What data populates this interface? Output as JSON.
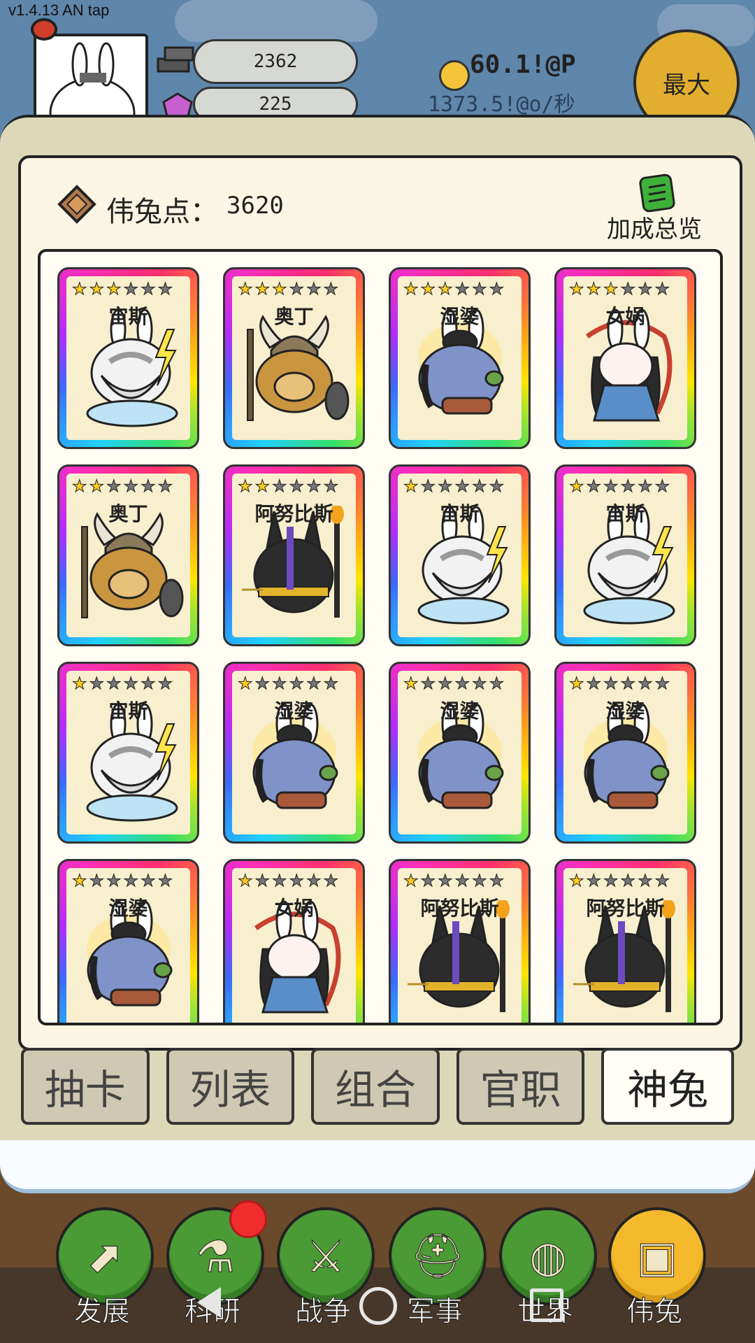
{
  "version": "v1.4.13 AN tap",
  "resources": {
    "iron": "2362",
    "gems": "225"
  },
  "income": {
    "coin_rate": "60.1!@P",
    "coin_per_sec": "1373.5!@o/秒"
  },
  "max_button": "最大",
  "panel": {
    "points_label": "伟兔点：",
    "points_value": "3620",
    "bonus_overview": "加成总览"
  },
  "cards": [
    {
      "name": "宙斯",
      "stars": 3,
      "char": "zeus"
    },
    {
      "name": "奥丁",
      "stars": 3,
      "char": "odin"
    },
    {
      "name": "湿婆",
      "stars": 3,
      "char": "shiva"
    },
    {
      "name": "女娲",
      "stars": 3,
      "char": "nuwa"
    },
    {
      "name": "奥丁",
      "stars": 2,
      "char": "odin"
    },
    {
      "name": "阿努比斯",
      "stars": 2,
      "char": "anubis"
    },
    {
      "name": "宙斯",
      "stars": 1,
      "char": "zeus"
    },
    {
      "name": "宙斯",
      "stars": 1,
      "char": "zeus"
    },
    {
      "name": "宙斯",
      "stars": 1,
      "char": "zeus"
    },
    {
      "name": "湿婆",
      "stars": 1,
      "char": "shiva"
    },
    {
      "name": "湿婆",
      "stars": 1,
      "char": "shiva"
    },
    {
      "name": "湿婆",
      "stars": 1,
      "char": "shiva"
    },
    {
      "name": "湿婆",
      "stars": 1,
      "char": "shiva"
    },
    {
      "name": "女娲",
      "stars": 1,
      "char": "nuwa"
    },
    {
      "name": "阿努比斯",
      "stars": 1,
      "char": "anubis"
    },
    {
      "name": "阿努比斯",
      "stars": 1,
      "char": "anubis"
    }
  ],
  "tabs": [
    {
      "label": "抽卡",
      "active": false
    },
    {
      "label": "列表",
      "active": false
    },
    {
      "label": "组合",
      "active": false
    },
    {
      "label": "官职",
      "active": false
    },
    {
      "label": "神兔",
      "active": true
    }
  ],
  "nav": [
    {
      "label": "发展",
      "icon": "axe-icon",
      "active": false
    },
    {
      "label": "科研",
      "icon": "flask-icon",
      "active": false,
      "badge": true
    },
    {
      "label": "战争",
      "icon": "swords-icon",
      "active": false
    },
    {
      "label": "军事",
      "icon": "helmet-icon",
      "active": false
    },
    {
      "label": "世界",
      "icon": "globe-icon",
      "active": false
    },
    {
      "label": "伟兔",
      "icon": "rabbit-portrait-icon",
      "active": true
    }
  ],
  "colors": {
    "active_nav": "#f4b82d",
    "nav": "#4a9a35",
    "star": "#ffcc1f"
  }
}
